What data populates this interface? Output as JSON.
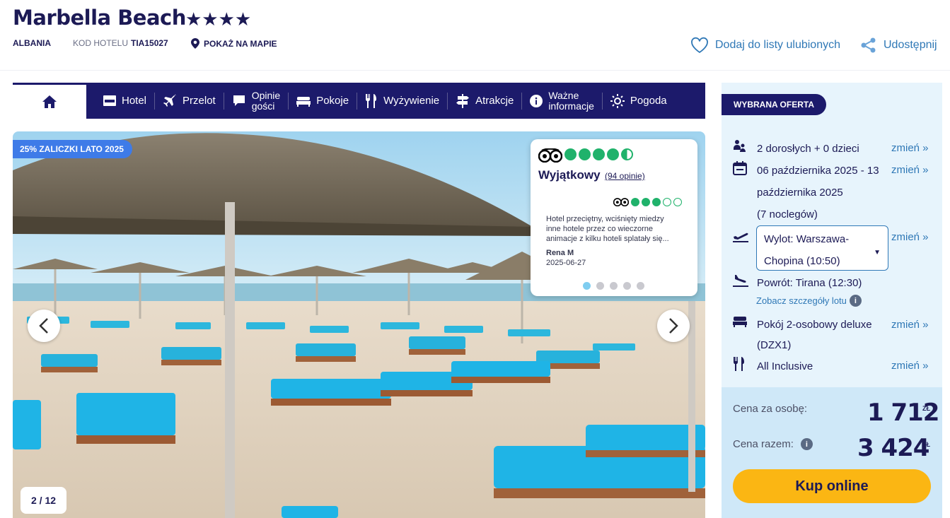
{
  "header": {
    "title": "Marbella Beach",
    "stars": "★★★★",
    "country": "ALBANIA",
    "code_label": "KOD HOTELU",
    "code_value": "TIA15027",
    "map_link": "POKAŻ NA MAPIE",
    "favorites_label": "Dodaj do listy ulubionych",
    "share_label": "Udostępnij"
  },
  "nav": {
    "items": [
      {
        "label": "Hotel",
        "icon": "hotel-icon"
      },
      {
        "label": "Przelot",
        "icon": "plane-icon"
      },
      {
        "label": "Opinie gości",
        "icon": "chat-icon"
      },
      {
        "label": "Pokoje",
        "icon": "bed-icon"
      },
      {
        "label": "Wyżywienie",
        "icon": "cutlery-icon"
      },
      {
        "label": "Atrakcje",
        "icon": "signpost-icon"
      },
      {
        "label": "Ważne informacje",
        "icon": "info-icon"
      },
      {
        "label": "Pogoda",
        "icon": "sun-icon"
      }
    ],
    "opinie_l1": "Opinie",
    "opinie_l2": "gości",
    "wazne_l1": "Ważne",
    "wazne_l2": "informacje"
  },
  "gallery": {
    "promo": "25% ZALICZKI LATO 2025",
    "counter": "2 / 12",
    "review": {
      "rating_word": "Wyjątkowy",
      "count": "(94 opinie)",
      "overall_rating": 4.5,
      "review_rating": 3,
      "text": "Hotel przeciętny, wciśnięty miedzy inne hotele przez co wieczorne animacje z kilku hoteli splatały się...",
      "author": "Rena M",
      "date": "2025-06-27",
      "pages": 5,
      "active_page": 1
    }
  },
  "offer": {
    "badge": "WYBRANA OFERTA",
    "guests": "2 dorosłych + 0 dzieci",
    "dates_l1": "06 października 2025 - 13",
    "dates_l2": "października 2025",
    "dates_l3": "(7 noclegów)",
    "departure_l1": "Wylot: Warszawa-",
    "departure_l2": "Chopina (10:50)",
    "return": "Powrót: Tirana (12:30)",
    "flight_details": "Zobacz szczegóły lotu",
    "room_l1": "Pokój 2-osobowy deluxe",
    "room_l2": "(DZX1)",
    "board": "All Inclusive",
    "change_label": "zmień »",
    "price_per_person_label": "Cena za osobę:",
    "price_per_person": "1 712",
    "price_total_label": "Cena razem:",
    "price_total": "3 424",
    "currency": "ZŁ",
    "buy_label": "Kup online"
  }
}
